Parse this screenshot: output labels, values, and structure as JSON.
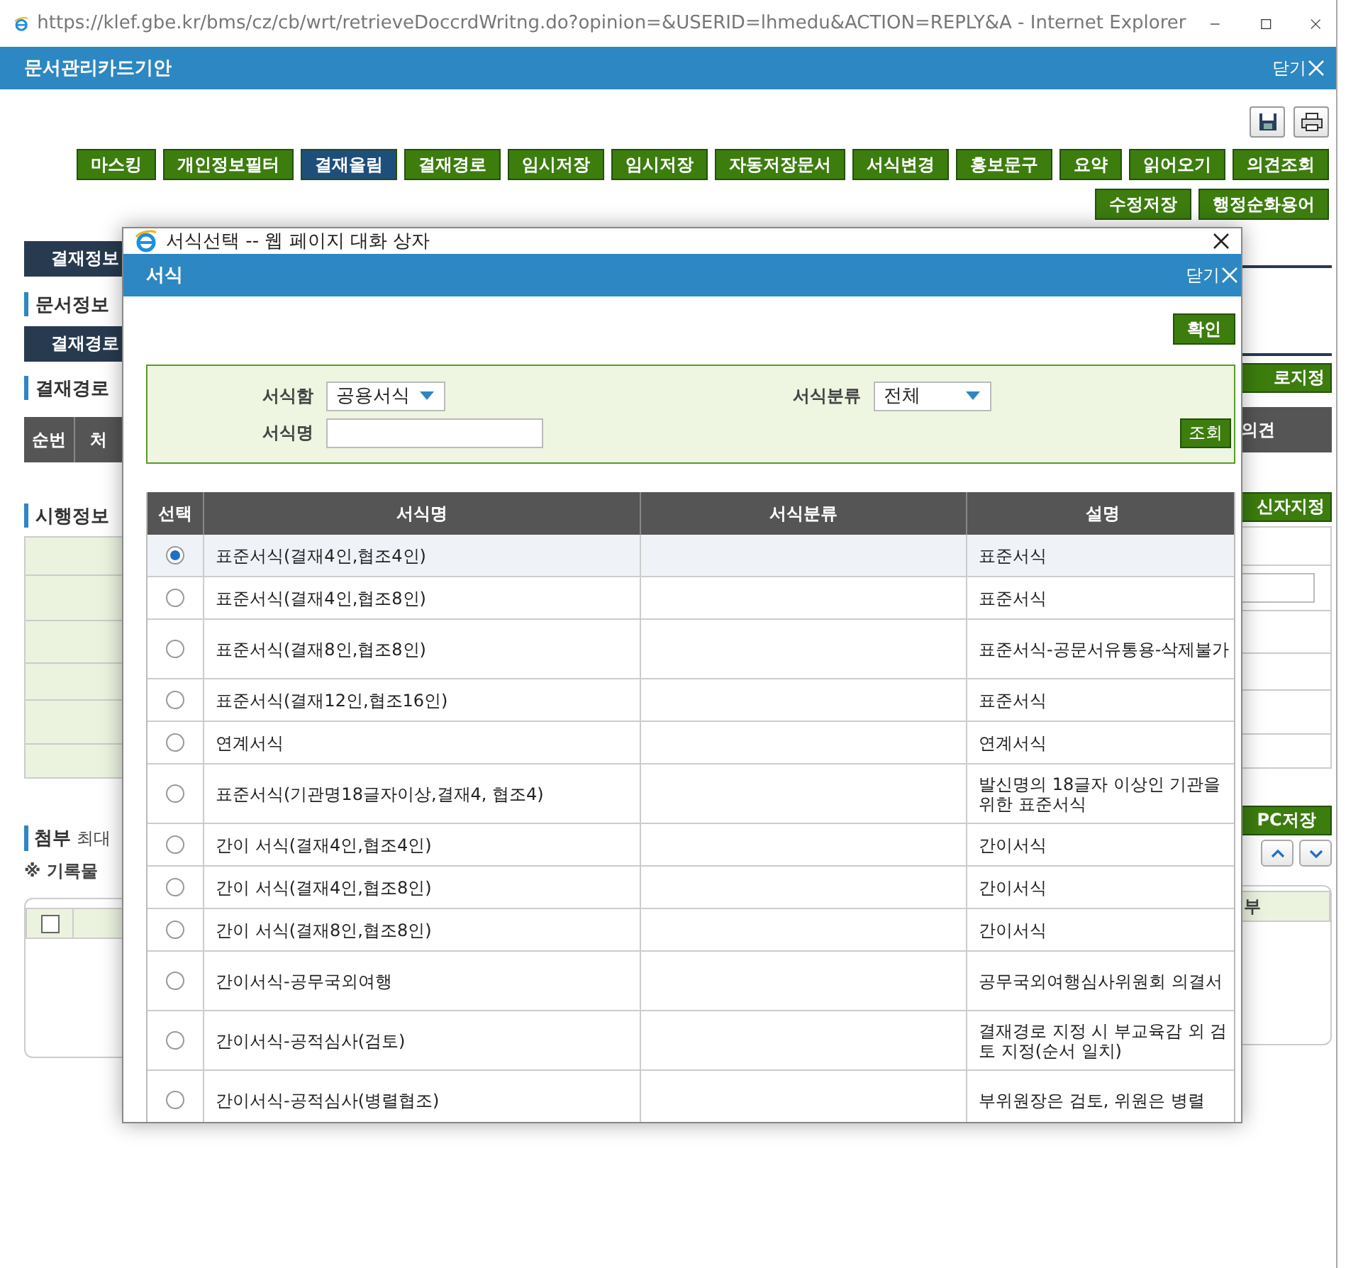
{
  "browser": {
    "title": "https://klef.gbe.kr/bms/cz/cb/wrt/retrieveDoccrdWritng.do?opinion=&USERID=lhmedu&ACTION=REPLY&A - Internet Explorer"
  },
  "app": {
    "title": "문서관리카드기안",
    "close": "닫기"
  },
  "toolbar": {
    "buttons": [
      {
        "label": "마스킹",
        "kind": "normal"
      },
      {
        "label": "개인정보필터",
        "kind": "normal"
      },
      {
        "label": "결재올림",
        "kind": "primary"
      },
      {
        "label": "결재경로",
        "kind": "normal"
      },
      {
        "label": "임시저장",
        "kind": "normal"
      },
      {
        "label": "임시저장",
        "kind": "normal"
      },
      {
        "label": "자동저장문서",
        "kind": "normal"
      },
      {
        "label": "서식변경",
        "kind": "normal"
      },
      {
        "label": "홍보문구",
        "kind": "normal"
      },
      {
        "label": "요약",
        "kind": "normal"
      },
      {
        "label": "읽어오기",
        "kind": "normal"
      },
      {
        "label": "의견조회",
        "kind": "normal"
      },
      {
        "label": "수정저장",
        "kind": "normal"
      },
      {
        "label": "행정순화용어",
        "kind": "normal"
      }
    ]
  },
  "left_panel": {
    "tab_1": "결재정보",
    "section_1": "문서정보",
    "tab_2": "결재경로",
    "section_2": "결재경로",
    "table_header": [
      "순번",
      "처"
    ],
    "section_3": "시행정보",
    "attachment_title": "첨부",
    "attachment_note": "최대",
    "record_note": "※ 기록물",
    "attachment_checkbox": {
      "checked": false
    }
  },
  "right_panel": {
    "route_button": "로지정",
    "table_header": "의견",
    "recipient_button": "신자지정",
    "pc_save_button": "PC저장",
    "list_header": "부"
  },
  "dialog": {
    "title": "서식선택 -- 웹 페이지 대화 상자",
    "header": "서식",
    "close": "닫기",
    "confirm_button": "확인",
    "filter": {
      "box_label": "서식함",
      "box_value": "공용서식",
      "category_label": "서식분류",
      "category_value": "전체",
      "name_label": "서식명",
      "search_button": "조회"
    },
    "table": {
      "columns": [
        "선택",
        "서식명",
        "서식분류",
        "설명"
      ],
      "rows": [
        {
          "name": "표준서식(결재4인,협조4인)",
          "description": "표준서식",
          "selected": true
        },
        {
          "name": "표준서식(결재4인,협조8인)",
          "description": "표준서식",
          "selected": false
        },
        {
          "name": "표준서식(결재8인,협조8인)",
          "description": "표준서식-공문서유통용-삭제불가",
          "selected": false
        },
        {
          "name": "표준서식(결재12인,협조16인)",
          "description": "표준서식",
          "selected": false
        },
        {
          "name": "연계서식",
          "description": "연계서식",
          "selected": false
        },
        {
          "name": "표준서식(기관명18글자이상,결재4, 협조4)",
          "description": "발신명의 18글자 이상인 기관을 위한 표준서식",
          "selected": false
        },
        {
          "name": "간이 서식(결재4인,협조4인)",
          "description": "간이서식",
          "selected": false
        },
        {
          "name": "간이 서식(결재4인,협조8인)",
          "description": "간이서식",
          "selected": false
        },
        {
          "name": "간이 서식(결재8인,협조8인)",
          "description": "간이서식",
          "selected": false
        },
        {
          "name": "간이서식-공무국외여행",
          "description": "공무국외여행심사위원회 의결서",
          "selected": false
        },
        {
          "name": "간이서식-공적심사(검토)",
          "description": "결재경로 지정 시 부교육감 외 검토 지정(순서 일치)",
          "selected": false
        },
        {
          "name": "간이서식-공적심사(병렬협조)",
          "description": "부위원장은 검토, 위원은 병렬",
          "selected": false
        }
      ]
    }
  }
}
